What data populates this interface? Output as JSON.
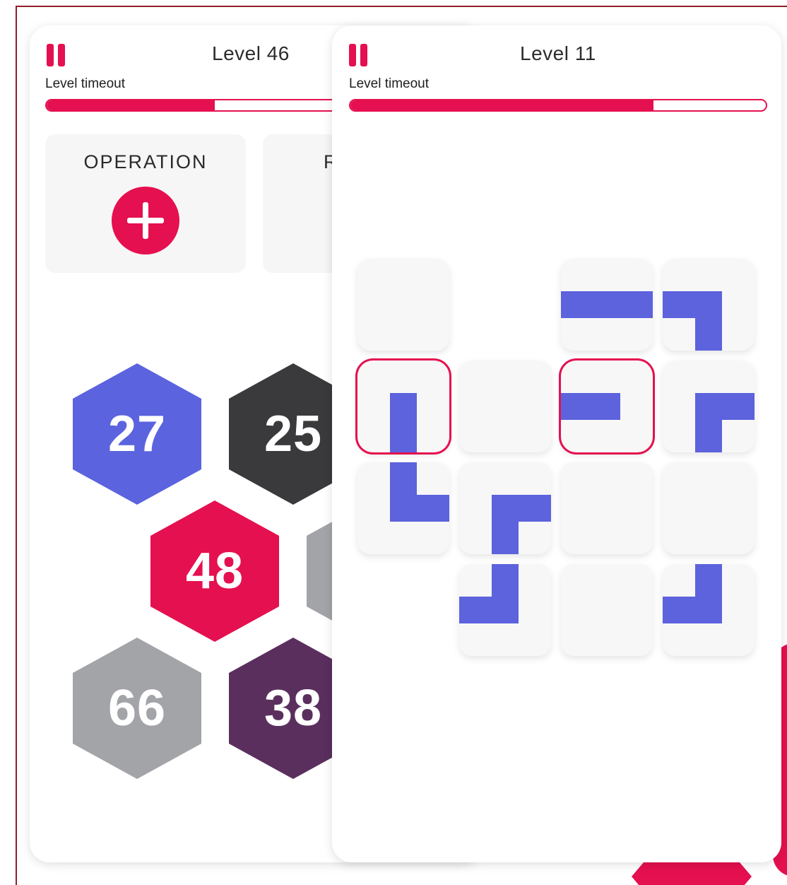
{
  "colors": {
    "accent": "#e5104f",
    "pipe": "#5d62dd"
  },
  "left_screen": {
    "level": "Level 46",
    "timeout_label": "Level timeout",
    "timeout_progress": 0.5,
    "operation_panel": {
      "title": "OPERATION",
      "operator": "+"
    },
    "second_panel": {
      "title_visible_fragment": "R"
    },
    "hexagons": [
      {
        "value": "27",
        "color": "#5b63de"
      },
      {
        "value": "25",
        "color": "#3a3a3c"
      },
      {
        "value": "48",
        "color": "#e5104f"
      },
      {
        "value": "66",
        "color": "#a3a4a8"
      },
      {
        "value": "38",
        "color": "#5a2f5e"
      }
    ]
  },
  "right_screen": {
    "level": "Level 11",
    "timeout_label": "Level timeout",
    "timeout_progress": 0.73,
    "selected_tiles": [
      "r2c1",
      "r2c3"
    ]
  }
}
